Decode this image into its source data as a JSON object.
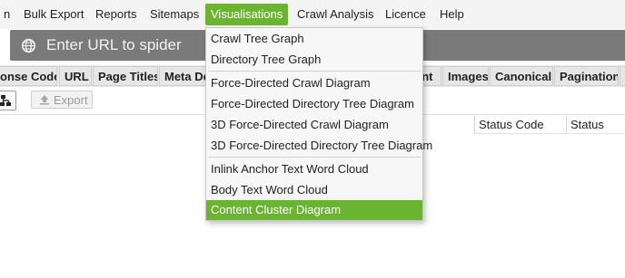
{
  "menubar": {
    "items": [
      {
        "label": "n"
      },
      {
        "label": "Bulk Export"
      },
      {
        "label": "Reports"
      },
      {
        "label": "Sitemaps"
      },
      {
        "label": "Visualisations"
      },
      {
        "label": "Crawl Analysis"
      },
      {
        "label": "Licence"
      },
      {
        "label": "Help"
      }
    ],
    "active_color": "#6bb431"
  },
  "urlbar": {
    "placeholder": "Enter URL to spider",
    "icon": "globe-icon"
  },
  "tabs": [
    {
      "label": "onse Codes"
    },
    {
      "label": "URL"
    },
    {
      "label": "Page Titles"
    },
    {
      "label": "Meta De"
    },
    {
      "label": "ent"
    },
    {
      "label": "Images"
    },
    {
      "label": "Canonicals"
    },
    {
      "label": "Pagination"
    },
    {
      "label": ""
    }
  ],
  "toolbar": {
    "tree_icon": "tree-view-icon",
    "export_label": "Export",
    "export_icon": "upload-icon"
  },
  "columns": [
    {
      "label": "Status Code"
    },
    {
      "label": "Status"
    }
  ],
  "dropdown": {
    "groups": [
      {
        "items": [
          {
            "label": "Crawl Tree Graph"
          },
          {
            "label": "Directory Tree Graph"
          }
        ]
      },
      {
        "items": [
          {
            "label": "Force-Directed Crawl Diagram"
          },
          {
            "label": "Force-Directed Directory Tree Diagram"
          },
          {
            "label": "3D Force-Directed Crawl Diagram"
          },
          {
            "label": "3D Force-Directed Directory Tree Diagram"
          }
        ]
      },
      {
        "items": [
          {
            "label": "Inlink Anchor Text Word Cloud"
          },
          {
            "label": "Body Text Word Cloud"
          },
          {
            "label": "Content Cluster Diagram"
          }
        ]
      }
    ],
    "selected": "Content Cluster Diagram",
    "selected_color": "#6bb431"
  }
}
